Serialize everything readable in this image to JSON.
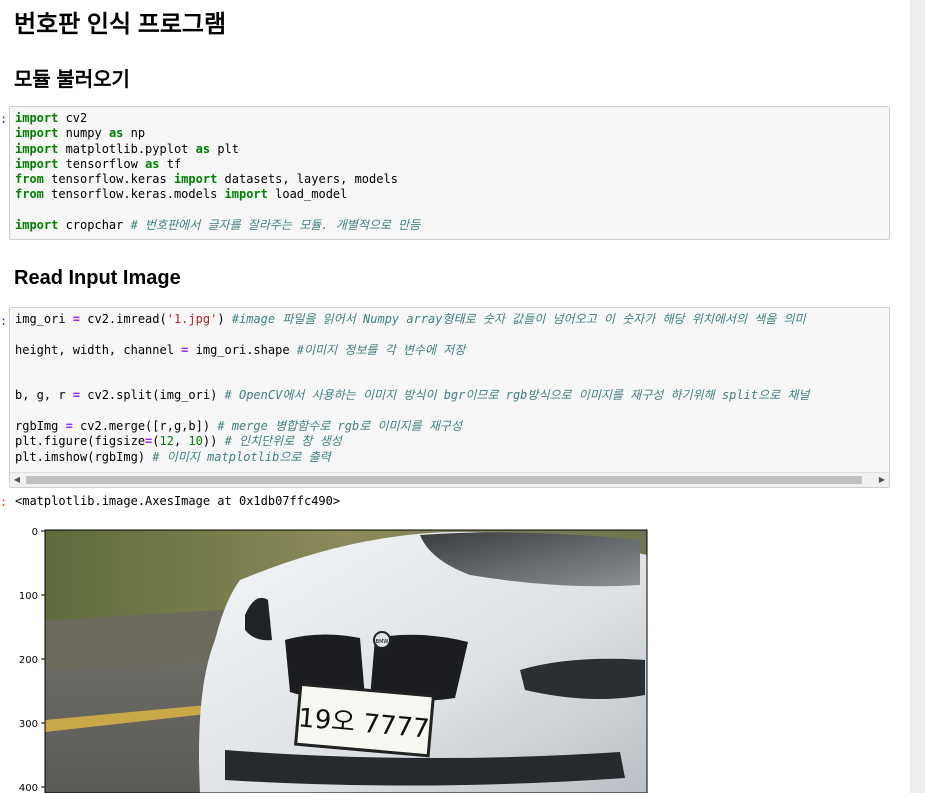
{
  "title": "번호판 인식 프로그램",
  "sections": {
    "import_heading": "모듈 불러오기",
    "read_heading": "Read Input Image"
  },
  "cell1": {
    "prompt": ":",
    "lines": [
      {
        "l1_kw": "import",
        "l1_rest": " cv2"
      },
      {
        "kw": "import",
        "mid": " numpy ",
        "op": "as",
        "rest": " np"
      },
      {
        "kw": "import",
        "mid": " matplotlib.pyplot ",
        "op": "as",
        "rest": " plt"
      },
      {
        "kw": "import",
        "mid": " tensorflow ",
        "op": "as",
        "rest": " tf"
      },
      {
        "kw": "from",
        "mid": " tensorflow.keras ",
        "kw2": "import",
        "rest": " datasets, layers, models"
      },
      {
        "kw": "from",
        "mid": " tensorflow.keras.models ",
        "kw2": "import",
        "rest": " load_model"
      },
      {
        "kw": "import",
        "mid": " cropchar ",
        "comment": "# 번호판에서 글자를 잘라주는 모듈. 개별적으로 만듬"
      }
    ]
  },
  "cell2": {
    "prompt": ":",
    "l1": {
      "a": "img_ori ",
      "eq": "=",
      "b": " cv2.imread(",
      "s": "'1.jpg'",
      "c": ") ",
      "cm": "#image 파일을 읽어서 Numpy array형태로 숫자 값들이 넘어오고 이 숫자가 해당 위치에서의 색을 의미"
    },
    "l2": {
      "a": "height, width, channel ",
      "eq": "=",
      "b": " img_ori.shape ",
      "cm": "#이미지 정보를 각 변수에 저장"
    },
    "l3": {
      "a": "b, g, r ",
      "eq": "=",
      "b": " cv2.split(img_ori) ",
      "cm": "# OpenCV에서 사용하는 이미지 방식이 bgr이므로 rgb방식으로 이미지를 재구성 하기위해 split으로 채널"
    },
    "l4": {
      "a": "rgbImg ",
      "eq": "=",
      "b": " cv2.merge([r,g,b]) ",
      "cm": "# merge 병합함수로 rgb로 이미지를 재구성"
    },
    "l5": {
      "a": "plt.figure(figsize",
      "eq": "=",
      "b": "(",
      "n1": "12",
      "c": ", ",
      "n2": "10",
      "d": ")) ",
      "cm": "# 인치단위로 창 생성"
    },
    "l6": {
      "a": "plt.imshow(rgbImg) ",
      "cm": "# 이미지 matplotlib으로 출력"
    }
  },
  "output": {
    "prompt": ":",
    "text": "<matplotlib.image.AxesImage at 0x1db07ffc490>",
    "yticks": [
      "0",
      "100",
      "200",
      "300",
      "400"
    ],
    "plate_text": "19오 7777",
    "emblem": "BMW"
  },
  "colors": {
    "keyword": "#008000",
    "operator": "#aa22ff",
    "string": "#ba2121",
    "comment": "#408080",
    "prompt": "#303f9f"
  }
}
